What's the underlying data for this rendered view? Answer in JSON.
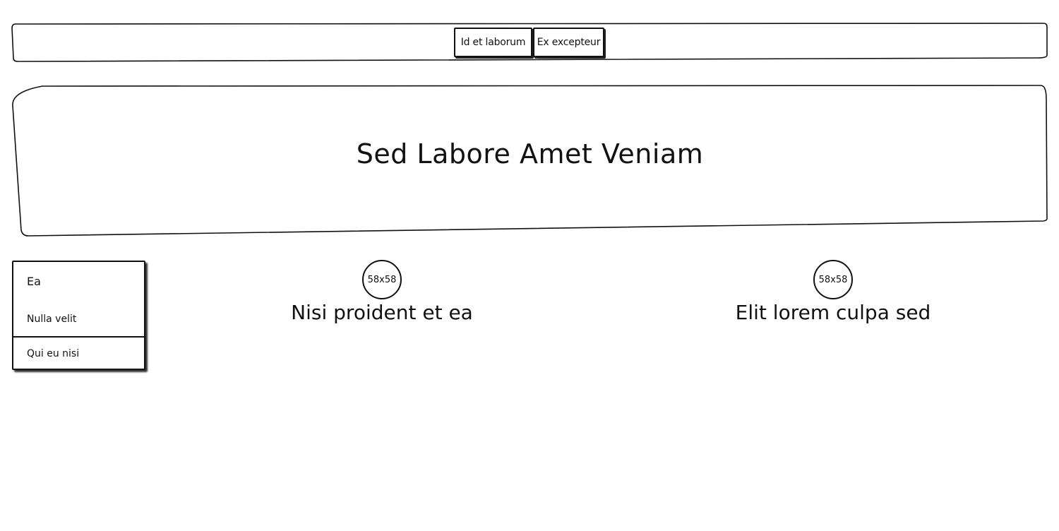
{
  "nav": {
    "buttons": [
      {
        "label": "Id et laborum"
      },
      {
        "label": "Ex excepteur"
      }
    ]
  },
  "hero": {
    "title": "Sed Labore Amet Veniam"
  },
  "side_menu": {
    "items": [
      {
        "label": "Ea"
      },
      {
        "label": "Nulla velit"
      },
      {
        "label": "Qui eu nisi"
      }
    ]
  },
  "features": [
    {
      "image_label": "58x58",
      "title": "Nisi proident et ea"
    },
    {
      "image_label": "58x58",
      "title": "Elit lorem culpa sed"
    }
  ]
}
